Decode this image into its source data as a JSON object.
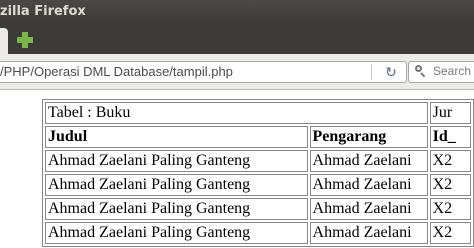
{
  "window": {
    "title": "zilla Firefox"
  },
  "toolbar": {
    "url": "/PHP/Operasi DML Database/tampil.php",
    "search_placeholder": "Search",
    "new_tab_icon": "plus-icon",
    "reload_icon": "reload-icon"
  },
  "page": {
    "caption_left": "Tabel : Buku",
    "caption_right": "Jur",
    "headers": [
      "Judul",
      "Pengarang",
      "Id_"
    ],
    "rows": [
      [
        "Ahmad Zaelani Paling Ganteng",
        "Ahmad Zaelani",
        "X2"
      ],
      [
        "Ahmad Zaelani Paling Ganteng",
        "Ahmad Zaelani",
        "X2"
      ],
      [
        "Ahmad Zaelani Paling Ganteng",
        "Ahmad Zaelani",
        "X2"
      ],
      [
        "Ahmad Zaelani Paling Ganteng",
        "Ahmad Zaelani",
        "X2"
      ]
    ]
  }
}
